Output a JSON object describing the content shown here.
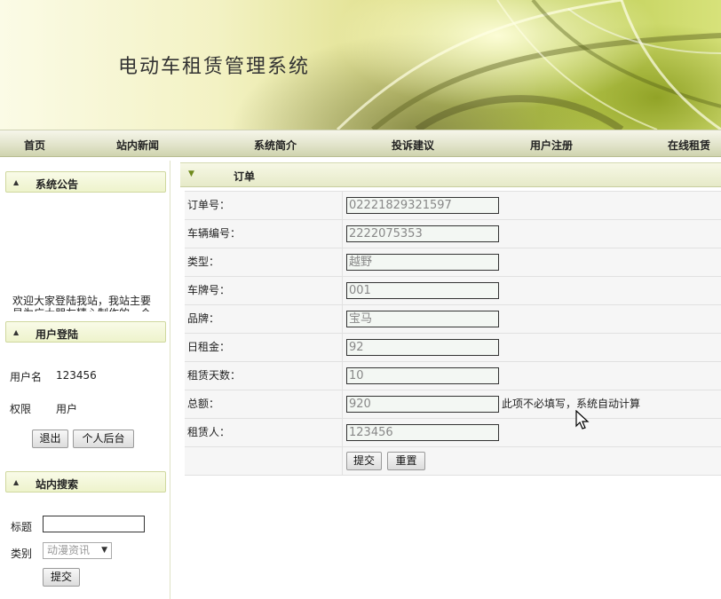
{
  "header": {
    "site_title": "电动车租赁管理系统"
  },
  "nav": {
    "items": [
      "首页",
      "站内新闻",
      "系统简介",
      "投诉建议",
      "用户注册",
      "在线租赁"
    ]
  },
  "sidebar": {
    "announcement": {
      "title": "系统公告",
      "text": "欢迎大家登陆我站，我站主要是为广大朋友精心制作的一个"
    },
    "login": {
      "title": "用户登陆",
      "username_label": "用户名",
      "username_value": "123456",
      "role_label": "权限",
      "role_value": "用户",
      "logout_button": "退出",
      "backend_button": "个人后台"
    },
    "search": {
      "title": "站内搜索",
      "title_label": "标题",
      "title_value": "",
      "category_label": "类别",
      "category_selected": "动漫资讯",
      "submit_button": "提交"
    }
  },
  "main": {
    "section_title": "订单",
    "fields": [
      {
        "label": "订单号：",
        "value": "02221829321597"
      },
      {
        "label": "车辆编号：",
        "value": "2222075353"
      },
      {
        "label": "类型：",
        "value": "越野"
      },
      {
        "label": "车牌号：",
        "value": "001"
      },
      {
        "label": "品牌：",
        "value": "宝马"
      },
      {
        "label": "日租金：",
        "value": "92"
      },
      {
        "label": "租赁天数：",
        "value": "10"
      },
      {
        "label": "总额：",
        "value": "920",
        "note": "此项不必填写，系统自动计算"
      },
      {
        "label": "租赁人：",
        "value": "123456"
      }
    ],
    "submit_button": "提交",
    "reset_button": "重置"
  },
  "icons": {
    "collapse": "triangle-icon",
    "expand": "triangle-down-icon",
    "select_arrow": "chevron-down-icon",
    "cursor": "mouse-pointer-icon"
  },
  "colors": {
    "accent_green": "#6f8a1d",
    "panel_header": "#eef3cc",
    "row_background": "#f6f6f6"
  }
}
